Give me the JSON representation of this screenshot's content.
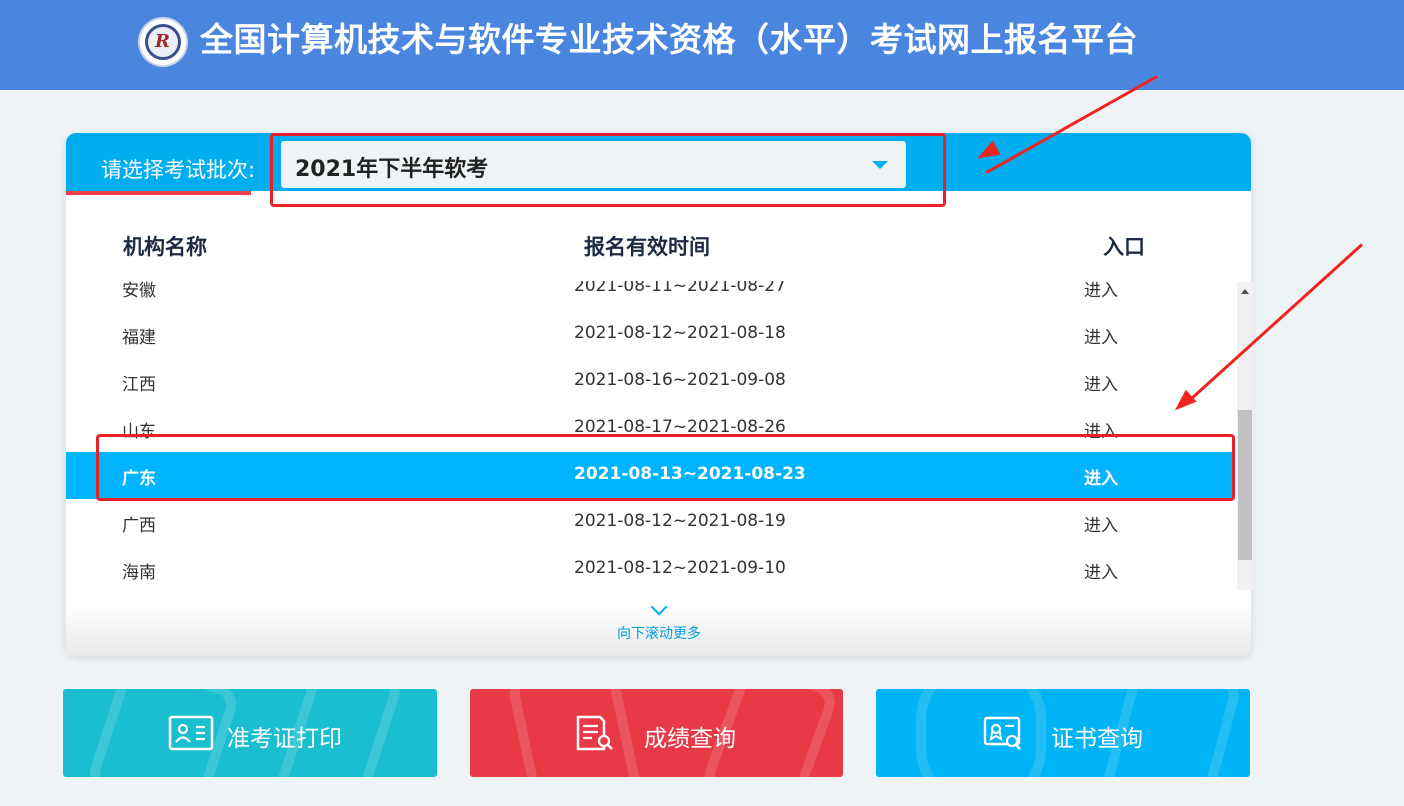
{
  "header": {
    "title": "全国计算机技术与软件专业技术资格（水平）考试网上报名平台",
    "logo_icon": "exam-logo"
  },
  "batch": {
    "label": "请选择考试批次:",
    "selected": "2021年下半年软考"
  },
  "table": {
    "headers": [
      "机构名称",
      "报名有效时间",
      "入口"
    ],
    "rows": [
      {
        "name": "安徽",
        "period": "2021-08-11~2021-08-27",
        "entry": "进入"
      },
      {
        "name": "福建",
        "period": "2021-08-12~2021-08-18",
        "entry": "进入"
      },
      {
        "name": "江西",
        "period": "2021-08-16~2021-09-08",
        "entry": "进入"
      },
      {
        "name": "山东",
        "period": "2021-08-17~2021-08-26",
        "entry": "进入"
      },
      {
        "name": "广东",
        "period": "2021-08-13~2021-08-23",
        "entry": "进入",
        "selected": true
      },
      {
        "name": "广西",
        "period": "2021-08-12~2021-08-19",
        "entry": "进入"
      },
      {
        "name": "海南",
        "period": "2021-08-12~2021-09-10",
        "entry": "进入"
      }
    ]
  },
  "scroll_more": "向下滚动更多",
  "actions": [
    {
      "label": "准考证打印",
      "icon": "id-card-icon",
      "color": "#1bbecf"
    },
    {
      "label": "成绩查询",
      "icon": "score-report-icon",
      "color": "#e83a46"
    },
    {
      "label": "证书查询",
      "icon": "certificate-search-icon",
      "color": "#00b4f5"
    }
  ],
  "colors": {
    "header": "#4a86e0",
    "accent": "#00aeef",
    "selected_row": "#00b4ff",
    "annotation": "#e8202a"
  }
}
